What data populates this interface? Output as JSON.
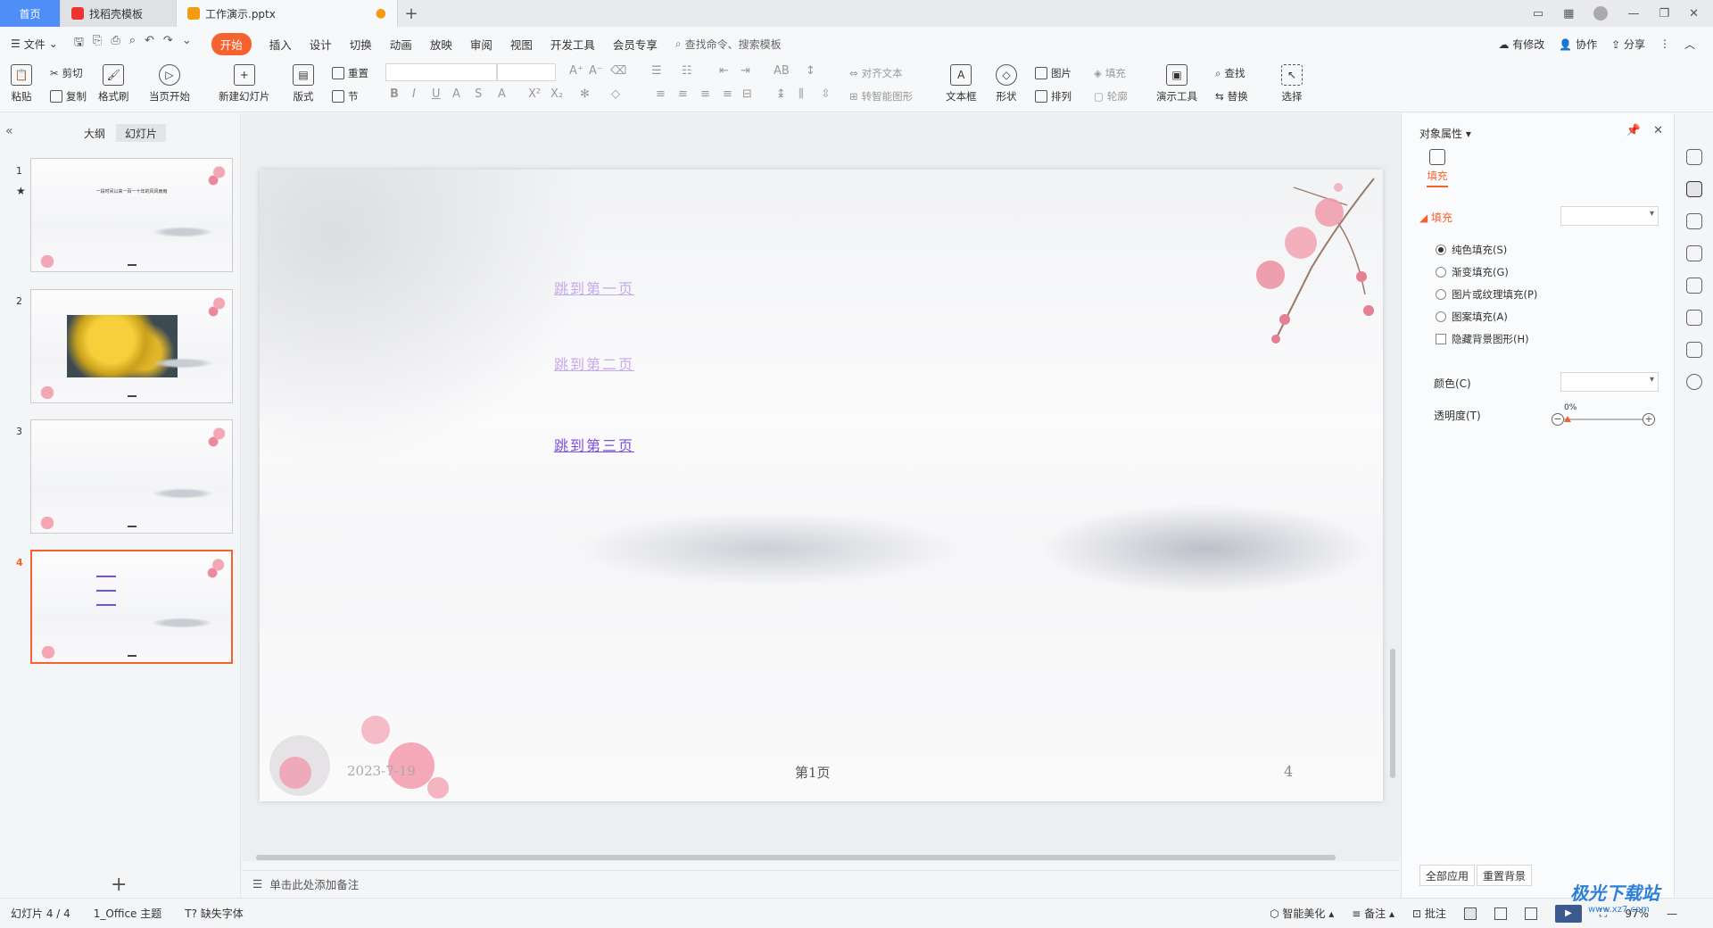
{
  "tabs": {
    "home": "首页",
    "template": "找稻壳模板",
    "doc": "工作演示.pptx"
  },
  "menu": {
    "file": "文件",
    "items": [
      "开始",
      "插入",
      "设计",
      "切换",
      "动画",
      "放映",
      "审阅",
      "视图",
      "开发工具",
      "会员专享"
    ],
    "search": "查找命令、搜索模板",
    "modified": "有修改",
    "collab": "协作",
    "share": "分享"
  },
  "ribbon": {
    "paste": "粘贴",
    "cut": "剪切",
    "copy": "复制",
    "format_painter": "格式刷",
    "from_current": "当页开始",
    "new_slide": "新建幻灯片",
    "layout": "版式",
    "section": "节",
    "reset": "重置",
    "align_text": "对齐文本",
    "smart_art": "转智能图形",
    "textbox": "文本框",
    "shape": "形状",
    "picture": "图片",
    "arrange": "排列",
    "fill": "填充",
    "outline": "轮廓",
    "present_tools": "演示工具",
    "find": "查找",
    "replace": "替换",
    "select": "选择"
  },
  "left_panel": {
    "outline_tab": "大纲",
    "slides_tab": "幻灯片",
    "slide_numbers": [
      "1",
      "2",
      "3",
      "4"
    ],
    "thumb1_title": "一段时间以来一百一十年的风风雨雨"
  },
  "slide": {
    "link1": "跳到第一页",
    "link2": "跳到第二页",
    "link3": "跳到第三页",
    "date": "2023-7-19",
    "page_label": "第1页",
    "number": "4"
  },
  "notes": {
    "placeholder": "单击此处添加备注"
  },
  "props": {
    "title": "对象属性",
    "fill_tab": "填充",
    "fill_section": "填充",
    "options": [
      "纯色填充(S)",
      "渐变填充(G)",
      "图片或纹理填充(P)",
      "图案填充(A)"
    ],
    "selected_option": "纯色填充(S)",
    "hide_bg": "隐藏背景图形(H)",
    "color_label": "颜色(C)",
    "transparency_label": "透明度(T)",
    "transparency_value": "0%",
    "apply_all": "全部应用",
    "reset_bg": "重置背景"
  },
  "status": {
    "slide_info": "幻灯片 4 / 4",
    "theme": "1_Office 主题",
    "missing_fonts": "缺失字体",
    "beautify": "智能美化",
    "notes": "备注",
    "comments": "批注",
    "zoom": "97%"
  },
  "watermark": {
    "text": "极光下载站",
    "url": "www.xz7.com"
  },
  "colors": {
    "accent": "#f6622d",
    "home_tab": "#4f8ef7",
    "link_active": "#7b4fd9",
    "link_visited": "#c6a9e8"
  }
}
